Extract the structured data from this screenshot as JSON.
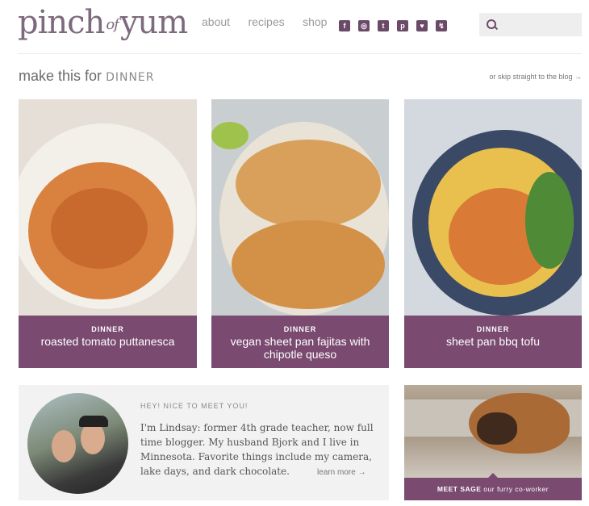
{
  "brand": {
    "logo_left": "pinch",
    "logo_mid": "of",
    "logo_right": "yum"
  },
  "nav": {
    "items": [
      "about",
      "recipes",
      "shop"
    ]
  },
  "social": {
    "icons": [
      "facebook-icon",
      "instagram-icon",
      "twitter-icon",
      "pinterest-icon",
      "heart-icon",
      "bolt-icon"
    ]
  },
  "search": {
    "placeholder": ""
  },
  "section": {
    "title_prefix": "make this for",
    "title_category": "DINNER",
    "skip_link": "or skip straight to the blog →"
  },
  "cards": [
    {
      "category": "DINNER",
      "name": "roasted tomato puttanesca"
    },
    {
      "category": "DINNER",
      "name": "vegan sheet pan fajitas with chipotle queso"
    },
    {
      "category": "DINNER",
      "name": "sheet pan bbq tofu"
    }
  ],
  "about": {
    "kicker": "HEY! NICE TO MEET YOU!",
    "intro": "I'm Lindsay: former 4th grade teacher, now full time blogger. My husband Bjork and I live in Minnesota. Favorite things include my camera, lake days, and dark chocolate.",
    "more_link": "learn more →"
  },
  "sage": {
    "caption_bold": "MEET SAGE",
    "caption_rest": " our furry co-worker"
  },
  "colors": {
    "accent": "#7a4a70",
    "logo": "#7d6a7c"
  }
}
